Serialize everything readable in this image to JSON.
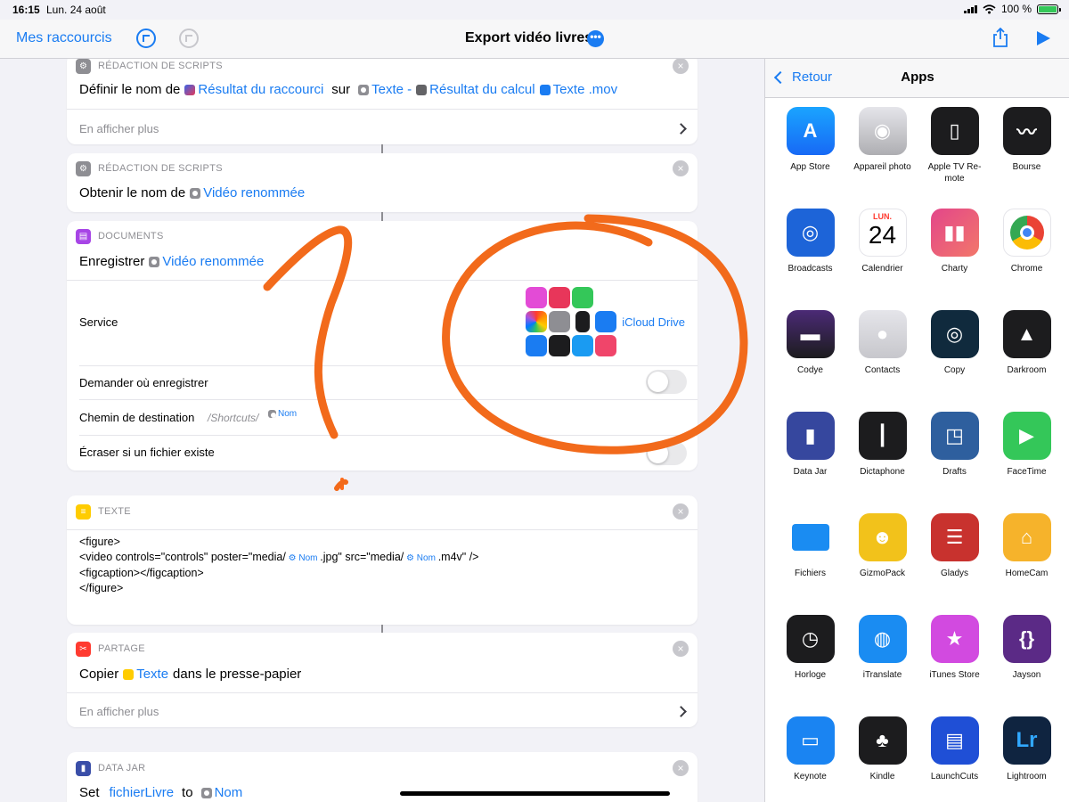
{
  "status": {
    "time": "16:15",
    "date": "Lun. 24 août",
    "battery": "100 %"
  },
  "nav": {
    "back_label": "Mes raccourcis",
    "title": "Export vidéo livres",
    "more_glyph": "•••"
  },
  "cards": {
    "c1": {
      "category": "RÉDACTION DE SCRIPTS",
      "verb": "Définir le nom de",
      "var1": "Résultat du raccourci",
      "word": "sur",
      "var2": "Texte -",
      "var3": "Résultat du calcul",
      "var4": "Texte .mov",
      "more": "En afficher plus"
    },
    "c2": {
      "category": "RÉDACTION DE SCRIPTS",
      "verb": "Obtenir le nom de",
      "var1": "Vidéo renommée"
    },
    "c3": {
      "category": "DOCUMENTS",
      "verb": "Enregistrer",
      "var1": "Vidéo renommée",
      "service_label": "Service",
      "service_value": "iCloud Drive",
      "ask_label": "Demander où enregistrer",
      "dest_label": "Chemin de destination",
      "dest_path": "/Shortcuts/",
      "dest_var": "Nom",
      "overwrite_label": "Écraser si un fichier existe"
    },
    "c4": {
      "category": "TEXTE",
      "line1": "<figure>",
      "line2a": "<video controls=\"controls\" poster=\"media/",
      "line2_var1": "Nom",
      "line2b": ".jpg\" src=\"media/",
      "line2_var2": "Nom",
      "line2c": ".m4v\" />",
      "line3": "<figcaption></figcaption>",
      "line4": "</figure>"
    },
    "c5": {
      "category": "PARTAGE",
      "verb": "Copier",
      "var1": "Texte",
      "rest": "dans le presse-papier",
      "more": "En afficher plus"
    },
    "c6": {
      "category": "DATA JAR",
      "verb": "Set",
      "var1": "fichierLivre",
      "word": "to",
      "var2": "Nom"
    }
  },
  "panel": {
    "back_label": "Retour",
    "title": "Apps",
    "apps": [
      {
        "name": "App Store",
        "icon": "appstore-icon"
      },
      {
        "name": "Appareil photo",
        "icon": "camera-icon"
      },
      {
        "name": "Apple TV Re-mote",
        "icon": "tv-remote-icon"
      },
      {
        "name": "Bourse",
        "icon": "stocks-icon"
      },
      {
        "name": "Broadcasts",
        "icon": "broadcast-icon"
      },
      {
        "name": "Calendrier",
        "icon": "calendar-icon",
        "cal_day": "LUN.",
        "cal_date": "24"
      },
      {
        "name": "Charty",
        "icon": "charty-icon"
      },
      {
        "name": "Chrome",
        "icon": "chrome-icon"
      },
      {
        "name": "Codye",
        "icon": "codye-icon"
      },
      {
        "name": "Contacts",
        "icon": "contacts-icon"
      },
      {
        "name": "Copy",
        "icon": "fingerprint-icon"
      },
      {
        "name": "Darkroom",
        "icon": "darkroom-icon"
      },
      {
        "name": "Data Jar",
        "icon": "jar-icon"
      },
      {
        "name": "Dictaphone",
        "icon": "voice-memo-icon"
      },
      {
        "name": "Drafts",
        "icon": "drafts-icon"
      },
      {
        "name": "FaceTime",
        "icon": "facetime-icon"
      },
      {
        "name": "Fichiers",
        "icon": "folder-icon"
      },
      {
        "name": "GizmoPack",
        "icon": "gizmo-icon"
      },
      {
        "name": "Gladys",
        "icon": "gladys-icon"
      },
      {
        "name": "HomeCam",
        "icon": "homecam-icon"
      },
      {
        "name": "Horloge",
        "icon": "clock-icon"
      },
      {
        "name": "iTranslate",
        "icon": "globe-icon"
      },
      {
        "name": "iTunes Store",
        "icon": "star-icon"
      },
      {
        "name": "Jayson",
        "icon": "json-icon"
      },
      {
        "name": "Keynote",
        "icon": "keynote-icon"
      },
      {
        "name": "Kindle",
        "icon": "kindle-icon"
      },
      {
        "name": "LaunchCuts",
        "icon": "launchcuts-icon"
      },
      {
        "name": "Lightroom",
        "icon": "lightroom-icon",
        "glyph": "Lr"
      }
    ]
  }
}
